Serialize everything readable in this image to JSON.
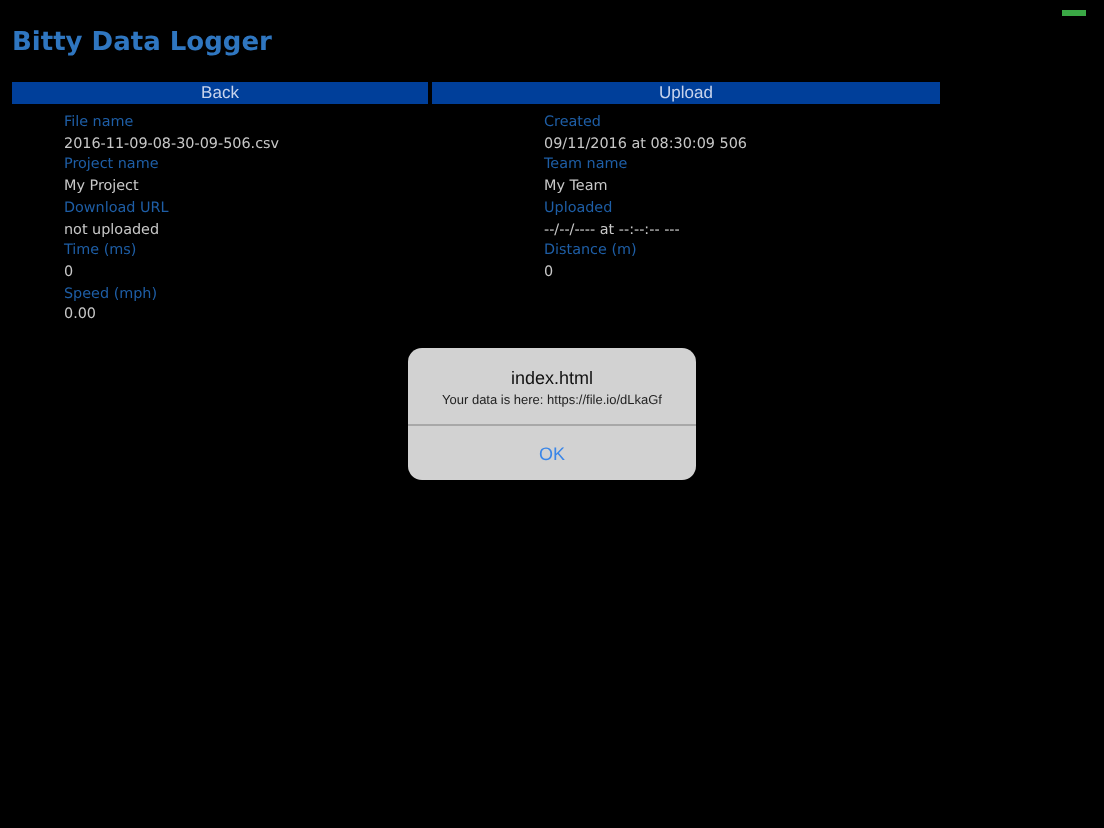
{
  "title": "Bitty Data Logger",
  "buttons": [
    "Back",
    "Upload"
  ],
  "fields": [
    {
      "label": "File name",
      "value": "2016-11-09-08-30-09-506.csv"
    },
    {
      "label": "Created",
      "value": "09/11/2016 at 08:30:09 506"
    },
    {
      "label": "Project name",
      "value": "My Project"
    },
    {
      "label": "Team name",
      "value": "My Team"
    },
    {
      "label": "Download URL",
      "value": "not uploaded"
    },
    {
      "label": "Uploaded",
      "value": "--/--/---- at --:--:-- ---"
    },
    {
      "label": "Time (ms)",
      "value": "0"
    },
    {
      "label": "Distance (m)",
      "value": "0"
    },
    {
      "label": "Speed (mph)",
      "value": "0.00"
    }
  ],
  "dialog": {
    "title": "index.html",
    "message": "Your data is here: https://file.io/dLkaGf",
    "button": "OK"
  }
}
